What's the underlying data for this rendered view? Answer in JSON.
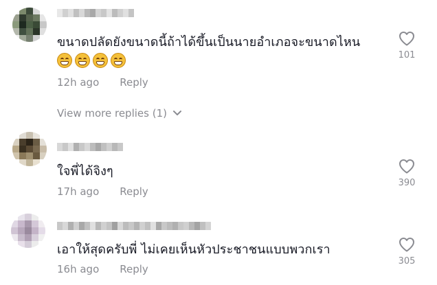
{
  "comments": [
    {
      "text": "ขนาดปลัดยังขนาดนี้ถ้าได้ขึ้นเป็นนายอำเภอจะขนาดไหน",
      "emoji_count": 4,
      "emoji": "grimacing-face-emoji",
      "time": "12h ago",
      "reply_label": "Reply",
      "likes": "101",
      "avatar_colors": [
        "#f2f2f2",
        "#7c8a6c",
        "#3c4a3a",
        "#d8d8d8",
        "#ffffff",
        "#9aa08e",
        "#2f3a2e",
        "#55624c",
        "#6d7a62",
        "#e6e6e6",
        "#8b9a7c",
        "#1e2a20",
        "#4a5e44",
        "#3a4a36",
        "#c8c8c8",
        "#b4b8ac",
        "#405040",
        "#607058",
        "#2a3428",
        "#e0e0e0",
        "#f0f0f0",
        "#a0a898",
        "#768070",
        "#d0d0d0",
        "#ffffff"
      ],
      "username_colors": [
        "#e8e8e8",
        "#d0d0d0",
        "#e0e0e0",
        "#c0c0c0",
        "#d8d8d8",
        "#b8b8b8",
        "#a8a8a8",
        "#d4d4d4",
        "#c8c8c8",
        "#e4e4e4",
        "#bcbcbc",
        "#d0d0d0",
        "#e0e0e0",
        "#c4c4c4"
      ]
    },
    {
      "text": "ใจพี่ได้จิงๆ",
      "time": "17h ago",
      "reply_label": "Reply",
      "likes": "390",
      "avatar_colors": [
        "#ffffff",
        "#e0dcd4",
        "#c8c0b0",
        "#e8e4dc",
        "#ffffff",
        "#d8d0c0",
        "#4a3e2c",
        "#2c2418",
        "#6a5c44",
        "#e4e0d8",
        "#b8a888",
        "#3a3020",
        "#5a4a34",
        "#7a6a50",
        "#c8bca8",
        "#d0c4ac",
        "#8a7858",
        "#a09070",
        "#6a5a40",
        "#d8d0c0",
        "#ffffff",
        "#e0d8c8",
        "#c0b498",
        "#e8e0d0",
        "#ffffff"
      ],
      "username_colors": [
        "#d8d8d8",
        "#c8c8c8",
        "#e0e0e0",
        "#b0b0b0",
        "#c8c8c8",
        "#d8d8d8",
        "#bcbcbc",
        "#a8a8a8",
        "#c0c0c0",
        "#d0d0d0",
        "#b8b8b8",
        "#c8c8c8"
      ]
    },
    {
      "text": "เอาให้สุดครับพี่ ไม่เคยเห็นหัวประชาชนแบบพวกเรา",
      "time": "16h ago",
      "reply_label": "Reply",
      "likes": "305",
      "avatar_colors": [
        "#ffffff",
        "#e8e4ec",
        "#d8d0dc",
        "#ececec",
        "#ffffff",
        "#e0d8e4",
        "#c8b8cc",
        "#a898ac",
        "#d4c8d8",
        "#f0ecf0",
        "#d0c4d4",
        "#b8a8bc",
        "#9a8a9e",
        "#c4b4c8",
        "#e4dce8",
        "#ece8ee",
        "#c8bccc",
        "#b0a0b4",
        "#d8d0dc",
        "#f0f0f0",
        "#ffffff",
        "#e8e0ea",
        "#d4ccd8",
        "#ececec",
        "#ffffff"
      ],
      "username_colors": [
        "#c8c8c8",
        "#d8d8d8",
        "#b0b0b0",
        "#d0d0d0",
        "#a8a8a8",
        "#c0c0c0",
        "#e0e0e0",
        "#b8b8b8",
        "#d0d0d0",
        "#c4c4c4",
        "#a0a0a0",
        "#d8d8d8",
        "#bcbcbc",
        "#c8c8c8",
        "#b4b4b4",
        "#d0d0d0",
        "#c0c0c0",
        "#e0e0e0",
        "#a8a8a8",
        "#c8c8c8",
        "#bcbcbc",
        "#b0b0b0",
        "#c8c8c8",
        "#d0d0d0",
        "#b8b8b8",
        "#a4a4a4",
        "#c0c0c0",
        "#d4d4d4"
      ]
    }
  ],
  "view_more": {
    "label": "View more replies (1)",
    "icon": "chevron-down-icon"
  },
  "colors": {
    "text": "#161823",
    "meta": "#8a8b91",
    "heart_stroke": "#8a8b91",
    "background": "#ffffff"
  }
}
